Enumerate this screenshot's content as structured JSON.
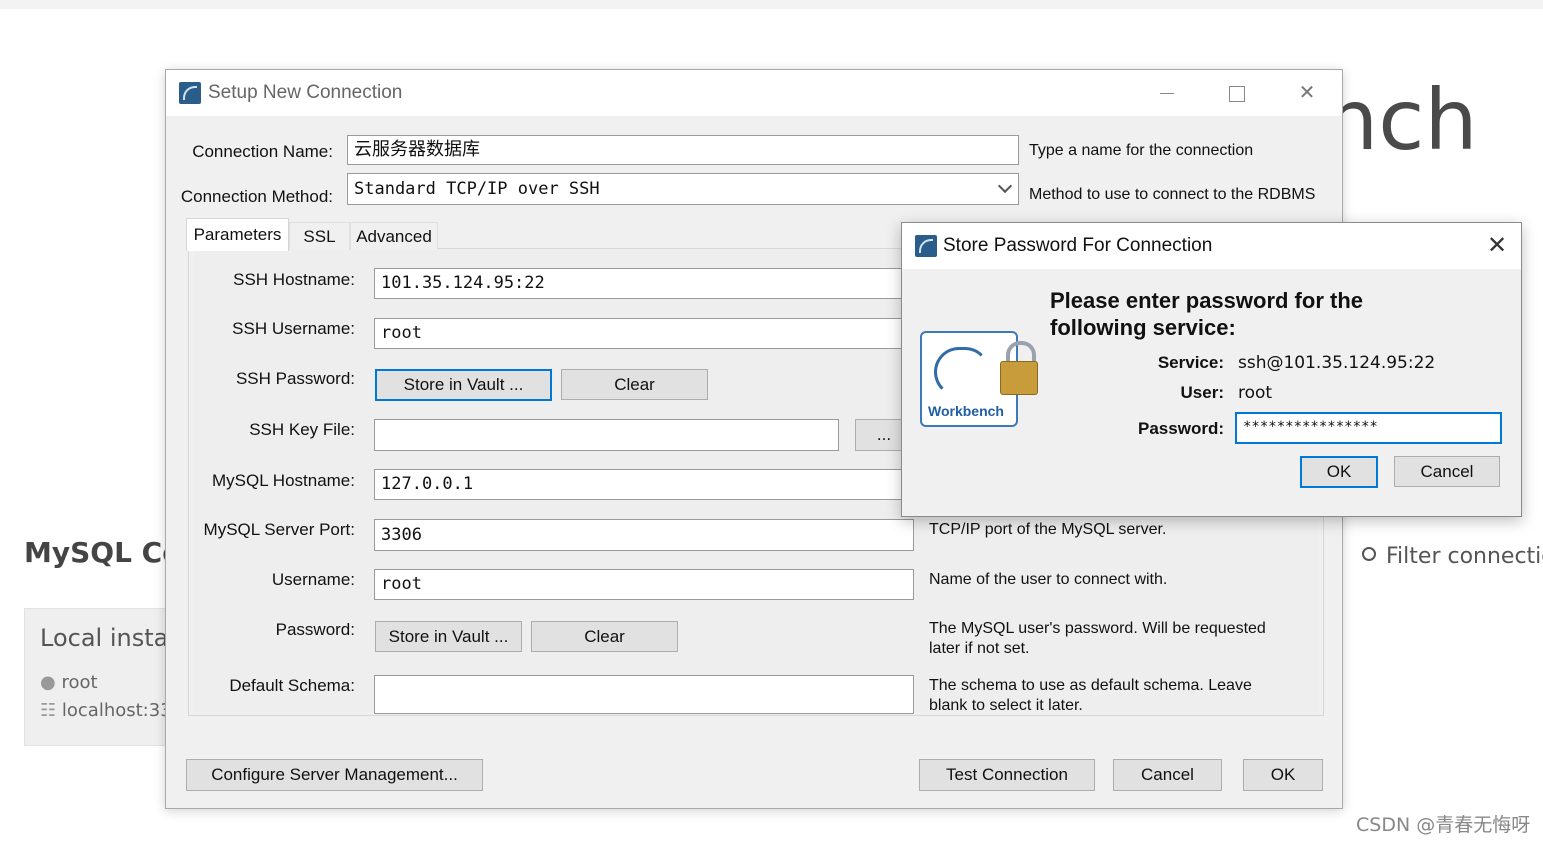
{
  "background": {
    "wordmark_fragment": "nch",
    "connections_heading": "MySQL Co",
    "filter_text": "Filter connectio",
    "card_title": "Local instar",
    "card_user": "root",
    "card_host": "localhost:33",
    "watermark": "CSDN @青春无悔呀"
  },
  "setup_dialog": {
    "title": "Setup New Connection",
    "connection_name_label": "Connection Name:",
    "connection_name_value": "云服务器数据库",
    "connection_name_hint": "Type a name for the connection",
    "connection_method_label": "Connection Method:",
    "connection_method_value": "Standard TCP/IP over SSH",
    "connection_method_hint": "Method to use to connect to the RDBMS",
    "tabs": [
      "Parameters",
      "SSL",
      "Advanced"
    ],
    "ssh_hostname_label": "SSH Hostname:",
    "ssh_hostname_value": "101.35.124.95:22",
    "ssh_username_label": "SSH Username:",
    "ssh_username_value": "root",
    "ssh_password_label": "SSH Password:",
    "store_in_vault_label": "Store in Vault ...",
    "clear_label": "Clear",
    "ssh_key_file_label": "SSH Key File:",
    "ssh_key_file_value": "",
    "browse_label": "...",
    "mysql_hostname_label": "MySQL Hostname:",
    "mysql_hostname_value": "127.0.0.1",
    "mysql_port_label": "MySQL Server Port:",
    "mysql_port_value": "3306",
    "mysql_port_hint": "TCP/IP port of the MySQL server.",
    "username_label": "Username:",
    "username_value": "root",
    "username_hint": "Name of the user to connect with.",
    "password_label": "Password:",
    "password_hint_line1": "The MySQL user's password. Will be requested",
    "password_hint_line2": "later if not set.",
    "default_schema_label": "Default Schema:",
    "default_schema_value": "",
    "default_schema_hint_line1": "The schema to use as default schema. Leave",
    "default_schema_hint_line2": "blank to select it later.",
    "configure_server_label": "Configure Server Management...",
    "test_connection_label": "Test Connection",
    "cancel_label": "Cancel",
    "ok_label": "OK"
  },
  "password_dialog": {
    "title": "Store Password For Connection",
    "heading_line1": "Please enter password for the",
    "heading_line2": "following service:",
    "logo_text": "Workbench",
    "service_label": "Service:",
    "service_value": "ssh@101.35.124.95:22",
    "user_label": "User:",
    "user_value": "root",
    "password_label": "Password:",
    "password_value": "****************",
    "ok_label": "OK",
    "cancel_label": "Cancel"
  },
  "colors": {
    "focus_accent": "#0078d7",
    "dialog_bg": "#f0f0f0"
  }
}
